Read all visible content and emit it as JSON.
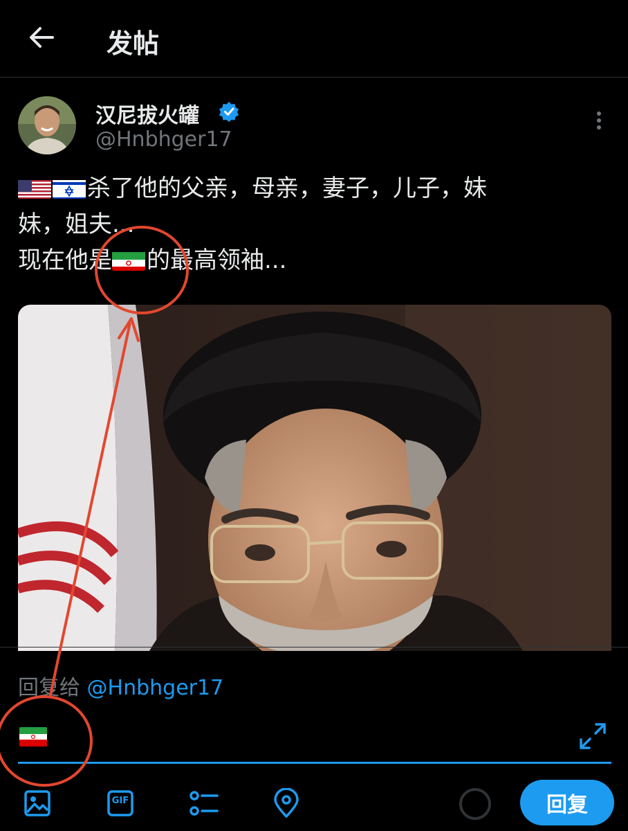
{
  "header": {
    "title": "发帖"
  },
  "post": {
    "display_name": "汉尼拔火罐",
    "handle": "@Hnbhger17",
    "text_line1": "杀了他的父亲，母亲，妻子，儿子，妹",
    "text_line2": "妹，姐夫...",
    "text_line3_before": "现在他是",
    "text_line3_after": "的最高领袖..."
  },
  "composer": {
    "reply_to_label": "回复给",
    "reply_to_handle": "@Hnbhger17",
    "reply_button": "回复"
  },
  "toolbar": {
    "gif_label": "GIF"
  },
  "colors": {
    "accent": "#1d9bf0",
    "annotation": "#e2472f",
    "background": "#000000"
  },
  "icons": [
    "back-arrow-icon",
    "verified-badge-icon",
    "more-vertical-icon",
    "expand-icon",
    "image-icon",
    "gif-icon",
    "poll-icon",
    "location-icon"
  ]
}
